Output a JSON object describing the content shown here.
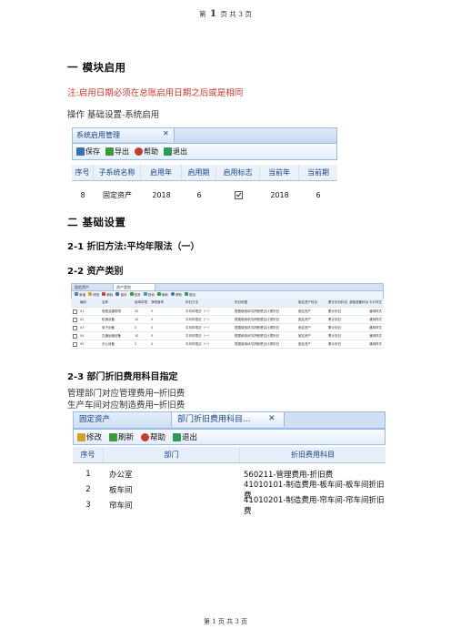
{
  "page_header": {
    "prefix": "第",
    "num": "1",
    "mid": "页 共",
    "total": "3",
    "suffix": "页"
  },
  "page_footer": {
    "text": "第 1 页 共 3 页"
  },
  "section1": {
    "title": "一  模块启用",
    "note": "注:启用日期必须在总账启用日期之后或是相同",
    "op": "操作  基础设置-系统启用"
  },
  "shot1": {
    "tab_title": "系统启用管理",
    "toolbar": [
      "保存",
      "导出",
      "帮助",
      "退出"
    ],
    "columns": [
      "序号",
      "子系统名称",
      "启用年",
      "启用期",
      "启用标志",
      "当前年",
      "当前期"
    ],
    "row": {
      "no": "8",
      "name": "固定资产",
      "year": "2018",
      "period": "6",
      "cur_year": "2018",
      "cur_period": "6"
    }
  },
  "section2": {
    "title": "二  基础设置",
    "s21": "2-1  折旧方法:平均年限法（一）",
    "s22": "2-2  资产类别",
    "s23": "2-3 部门折旧费用科目指定",
    "l1": "管理部门对应管理费用─折旧费",
    "l2": "生产车间对应制造费用─折旧费"
  },
  "shot2": {
    "tabs": [
      "固定资产",
      "资产类别"
    ],
    "toolbar": [
      "新增",
      "修改",
      "删除",
      "保存",
      "放弃",
      "查询",
      "刷新",
      "帮助",
      "退出"
    ],
    "columns": [
      "编码",
      "名称",
      "使用年限",
      "净残值率",
      "折旧方法",
      "折旧依据",
      "固定资产科目",
      "累计折旧科目",
      "减值准备科目",
      "卡片样式"
    ],
    "rows": [
      [
        "01",
        "房屋及建筑物",
        "30",
        "5",
        "平均年限法（一）",
        "根据使用状况判断是否计提折旧",
        "固定资产",
        "累计折旧",
        "",
        "通用样式"
      ],
      [
        "02",
        "机械设备",
        "10",
        "5",
        "平均年限法（一）",
        "根据使用状况判断是否计提折旧",
        "固定资产",
        "累计折旧",
        "",
        "通用样式"
      ],
      [
        "03",
        "电子设备",
        "5",
        "5",
        "平均年限法（一）",
        "根据使用状况判断是否计提折旧",
        "固定资产",
        "累计折旧",
        "",
        "通用样式"
      ],
      [
        "04",
        "交通运输设备",
        "10",
        "5",
        "平均年限法（一）",
        "根据使用状况判断是否计提折旧",
        "固定资产",
        "累计折旧",
        "",
        "通用样式"
      ],
      [
        "05",
        "办公设备",
        "5",
        "5",
        "平均年限法（一）",
        "根据使用状况判断是否计提折旧",
        "固定资产",
        "累计折旧",
        "",
        "通用样式"
      ]
    ]
  },
  "shot3": {
    "tabs": [
      "固定资产",
      "部门折旧费用科目..."
    ],
    "toolbar": [
      "修改",
      "刷新",
      "帮助",
      "退出"
    ],
    "columns": [
      "序号",
      "部门",
      "折旧费用科目"
    ],
    "rows": [
      {
        "no": "1",
        "dept": "办公室",
        "subject": "560211-管理费用-折旧费"
      },
      {
        "no": "2",
        "dept": "板车间",
        "subject": "41010101-制造费用-板车间-板车间折旧费"
      },
      {
        "no": "3",
        "dept": "帘车间",
        "subject": "41010201-制造费用-帘车间-帘车间折旧费"
      }
    ]
  },
  "colors": {
    "note_red": "#d2342b",
    "grid_blue": "#99bbe8",
    "header_text": "#15428b"
  }
}
